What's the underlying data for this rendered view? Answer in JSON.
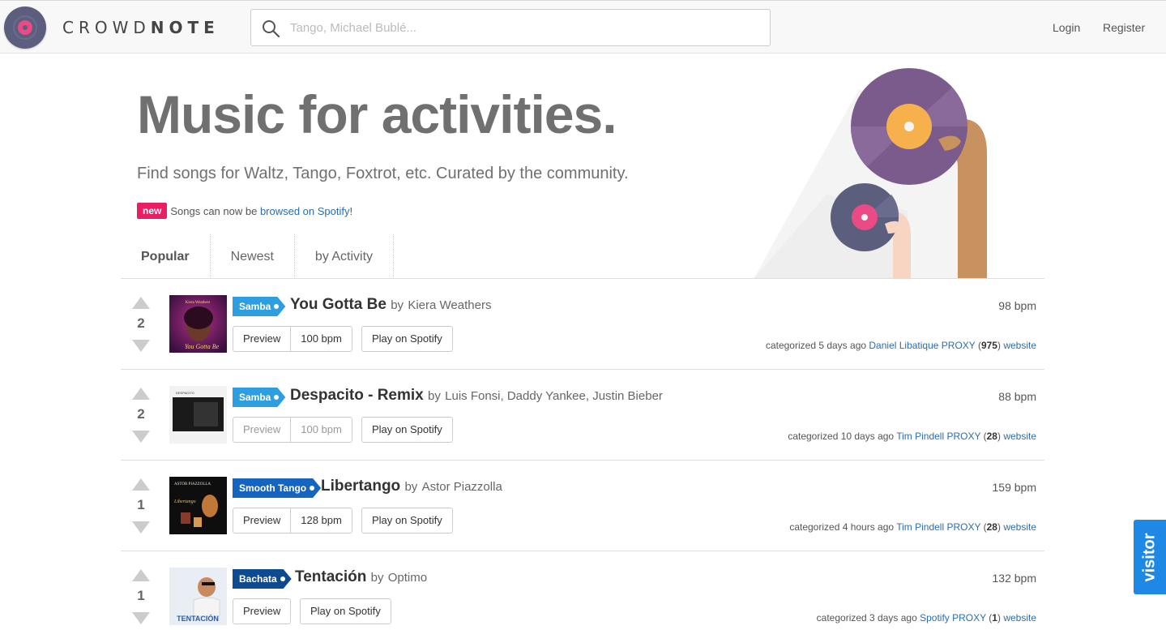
{
  "header": {
    "brand_light": "CROWD",
    "brand_bold": "NOTE",
    "search_placeholder": "Tango, Michael Bublé...",
    "login": "Login",
    "register": "Register"
  },
  "hero": {
    "title": "Music for activities.",
    "subtitle": "Find songs for Waltz, Tango, Foxtrot, etc. Curated by the community.",
    "badge": "new",
    "news_text": "Songs can now be",
    "news_link": "browsed on Spotify",
    "news_end": "!"
  },
  "tabs": [
    {
      "label": "Popular",
      "active": true
    },
    {
      "label": "Newest",
      "active": false
    },
    {
      "label": "by Activity",
      "active": false
    }
  ],
  "songs": [
    {
      "votes": "2",
      "genre": "Samba",
      "genre_color": "#2d9ee0",
      "title": "You Gotta Be",
      "by": "by",
      "artist": "Kiera Weathers",
      "preview": "Preview",
      "bpm_button": "100 bpm",
      "spotify": "Play on Spotify",
      "bpm": "98 bpm",
      "categorized": "categorized 5 days ago",
      "user": "Daniel Libatique PROXY",
      "count_open": "(",
      "count": "975",
      "count_close": ")",
      "website": "website"
    },
    {
      "votes": "2",
      "genre": "Samba",
      "genre_color": "#2d9ee0",
      "title": "Despacito - Remix",
      "by": "by",
      "artist": "Luis Fonsi, Daddy Yankee, Justin Bieber",
      "preview": "Preview",
      "bpm_button": "100 bpm",
      "spotify": "Play on Spotify",
      "bpm": "88 bpm",
      "categorized": "categorized 10 days ago",
      "user": "Tim Pindell PROXY",
      "count_open": "(",
      "count": "28",
      "count_close": ")",
      "website": "website"
    },
    {
      "votes": "1",
      "genre": "Smooth Tango",
      "genre_color": "#1565c0",
      "title": "Libertango",
      "by": "by",
      "artist": "Astor Piazzolla",
      "preview": "Preview",
      "bpm_button": "128 bpm",
      "spotify": "Play on Spotify",
      "bpm": "159 bpm",
      "categorized": "categorized 4 hours ago",
      "user": "Tim Pindell PROXY",
      "count_open": "(",
      "count": "28",
      "count_close": ")",
      "website": "website"
    },
    {
      "votes": "1",
      "genre": "Bachata",
      "genre_color": "#0d4a8f",
      "title": "Tentación",
      "by": "by",
      "artist": "Optimo",
      "preview": "Preview",
      "spotify": "Play on Spotify",
      "bpm": "132 bpm",
      "categorized": "categorized 3 days ago",
      "user": "Spotify PROXY",
      "count_open": "(",
      "count": "1",
      "count_close": ")",
      "website": "website"
    }
  ],
  "album_art": [
    {
      "caption_top": "Kiera Weathers",
      "caption_bottom": "You Gotta Be"
    },
    {
      "caption_top": "DESPACITO",
      "caption_bottom": ""
    },
    {
      "caption_top": "ASTOR PIAZZOLLA",
      "caption_bottom": "Libertango"
    },
    {
      "caption_top": "",
      "caption_bottom": "TENTACIÓN"
    }
  ],
  "visitor": "visitor",
  "colors": {
    "accent_pink": "#e91e63",
    "link_blue": "#2b6cb0",
    "visitor_blue": "#1e88e5"
  }
}
